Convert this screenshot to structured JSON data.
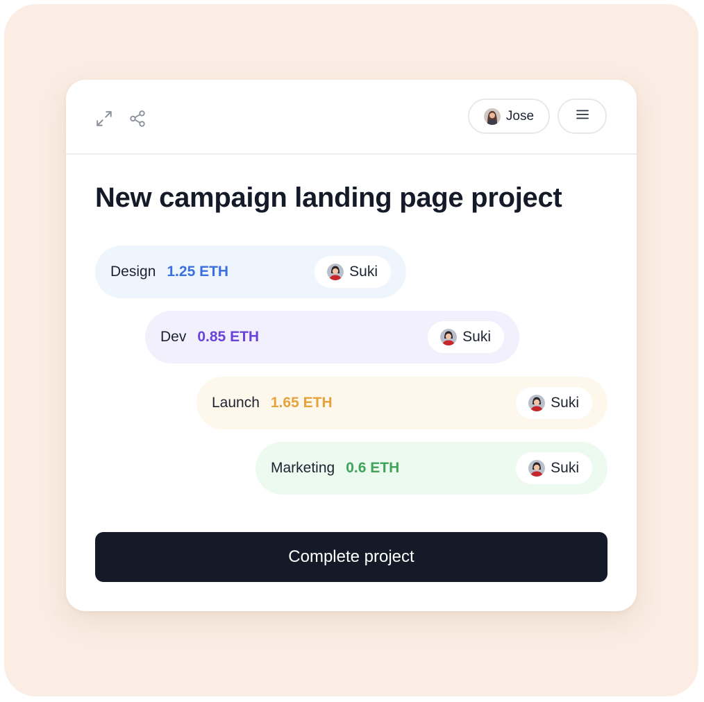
{
  "header": {
    "user": {
      "name": "Jose",
      "avatar": "user-avatar-photo"
    },
    "icons": {
      "expand": "expand-icon",
      "share": "share-icon",
      "menu": "hamburger-menu-icon"
    }
  },
  "project": {
    "title": "New campaign landing page project"
  },
  "tasks": [
    {
      "label": "Design",
      "amount": "1.25 ETH",
      "assignee": "Suki",
      "accent": "#3b6fe0",
      "bg": "#eef5fd"
    },
    {
      "label": "Dev",
      "amount": "0.85 ETH",
      "assignee": "Suki",
      "accent": "#6a43d8",
      "bg": "#f2f0fc"
    },
    {
      "label": "Launch",
      "amount": "1.65 ETH",
      "assignee": "Suki",
      "accent": "#e6a23c",
      "bg": "#fef8ec"
    },
    {
      "label": "Marketing",
      "amount": "0.6 ETH",
      "assignee": "Suki",
      "accent": "#3fa35a",
      "bg": "#edfaf0"
    }
  ],
  "actions": {
    "complete_label": "Complete project"
  },
  "colors": {
    "backdrop": "#fbede4",
    "primary_button": "#141a28"
  }
}
